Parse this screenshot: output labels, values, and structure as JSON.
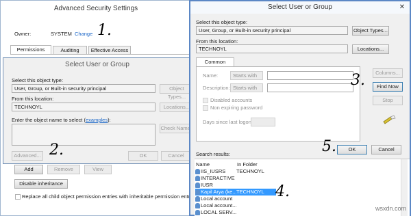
{
  "adv": {
    "title": "Advanced Security Settings",
    "owner_label": "Owner:",
    "owner_value": "SYSTEM",
    "change_link": "Change",
    "tabs": [
      "Permissions",
      "Auditing",
      "Effective Access"
    ],
    "buttons": {
      "add": "Add",
      "remove": "Remove",
      "view": "View",
      "disable": "Disable inheritance"
    },
    "replace_text": "Replace all child object permission entries with inheritable permission entries"
  },
  "back": {
    "title": "Select User or Group",
    "object_type_label": "Select this object type:",
    "object_type_value": "User, Group, or Built-in security principal",
    "object_types_btn": "Object Types...",
    "location_label": "From this location:",
    "location_value": "TECHNOYL",
    "locations_btn": "Locations...",
    "enter_label_pre": "Enter the object name to select (",
    "enter_label_link": "examples",
    "enter_label_post": "):",
    "check_names_btn": "Check Names",
    "advanced_btn": "Advanced...",
    "ok_btn": "OK",
    "cancel_btn": "Cancel"
  },
  "front": {
    "title": "Select User or Group",
    "close_glyph": "✕",
    "object_type_label": "Select this object type:",
    "object_type_value": "User, Group, or Built-in security principal",
    "object_types_btn": "Object Types...",
    "location_label": "From this location:",
    "location_value": "TECHNOYL",
    "locations_btn": "Locations...",
    "tab_common": "Common Queries",
    "name_label": "Name:",
    "description_label": "Description:",
    "starts_with": "Starts with",
    "disabled_accounts": "Disabled accounts",
    "non_expiring": "Non expiring password",
    "days_label": "Days since last logon:",
    "columns_btn": "Columns...",
    "find_now_btn": "Find Now",
    "stop_btn": "Stop",
    "ok_btn": "OK",
    "cancel_btn": "Cancel",
    "results_label": "Search results:",
    "col_name": "Name",
    "col_folder": "In Folder",
    "results": [
      {
        "name": "IIS_IUSRS",
        "folder": "TECHNOYL"
      },
      {
        "name": "INTERACTIVE",
        "folder": ""
      },
      {
        "name": "IUSR",
        "folder": ""
      },
      {
        "name": "Kapil Arya (ke...",
        "folder": "TECHNOYL"
      },
      {
        "name": "Local account",
        "folder": ""
      },
      {
        "name": "Local account...",
        "folder": ""
      },
      {
        "name": "LOCAL SERV...",
        "folder": ""
      }
    ]
  },
  "steps": [
    "1.",
    "2.",
    "3.",
    "4.",
    "5."
  ],
  "watermark": "wsxdn.com"
}
